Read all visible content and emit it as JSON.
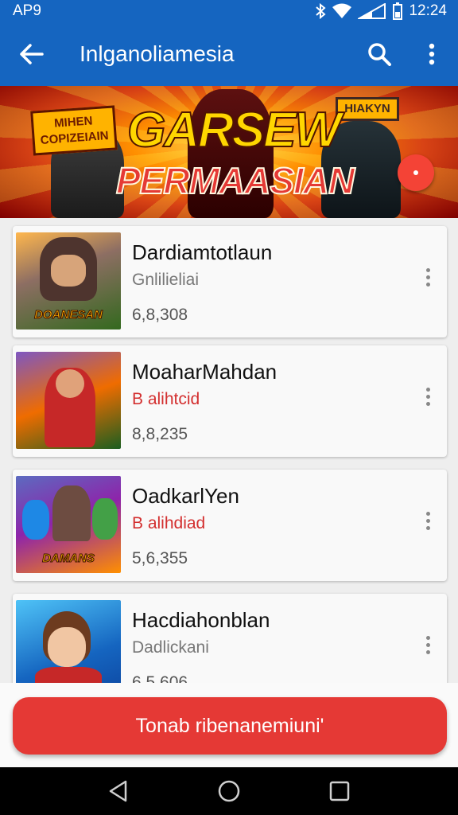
{
  "status_bar": {
    "carrier": "AP9",
    "time": "12:24"
  },
  "app_bar": {
    "title": "Inlganoliamesia"
  },
  "banner": {
    "tag_left": "MIHEN COPIZEIAIN",
    "title_line1": "GARSEW",
    "title_line2": "PERMAASIAN",
    "tag_right": "HIAKYN"
  },
  "games": [
    {
      "name": "Dardiamtotlaun",
      "subtitle": "Gnlilieliai",
      "count": "6,8,308",
      "subtitle_color": "#777777",
      "thumb_caption": "DOANESAN"
    },
    {
      "name": "MoaharMahdan",
      "subtitle": "B alihtcid",
      "count": "8,8,235",
      "subtitle_color": "#d32f2f",
      "thumb_caption": ""
    },
    {
      "name": "OadkarlYen",
      "subtitle": "B alihdiad",
      "count": "5,6,355",
      "subtitle_color": "#d32f2f",
      "thumb_caption": "DAMANS"
    },
    {
      "name": "Hacdiahonblan",
      "subtitle": "Dadlickani",
      "count": "6 5 606",
      "subtitle_color": "#777777",
      "thumb_caption": ""
    }
  ],
  "cta": {
    "label": "Tonab ribenanemiuni'"
  },
  "colors": {
    "primary": "#1565c0",
    "accent": "#e53935"
  }
}
